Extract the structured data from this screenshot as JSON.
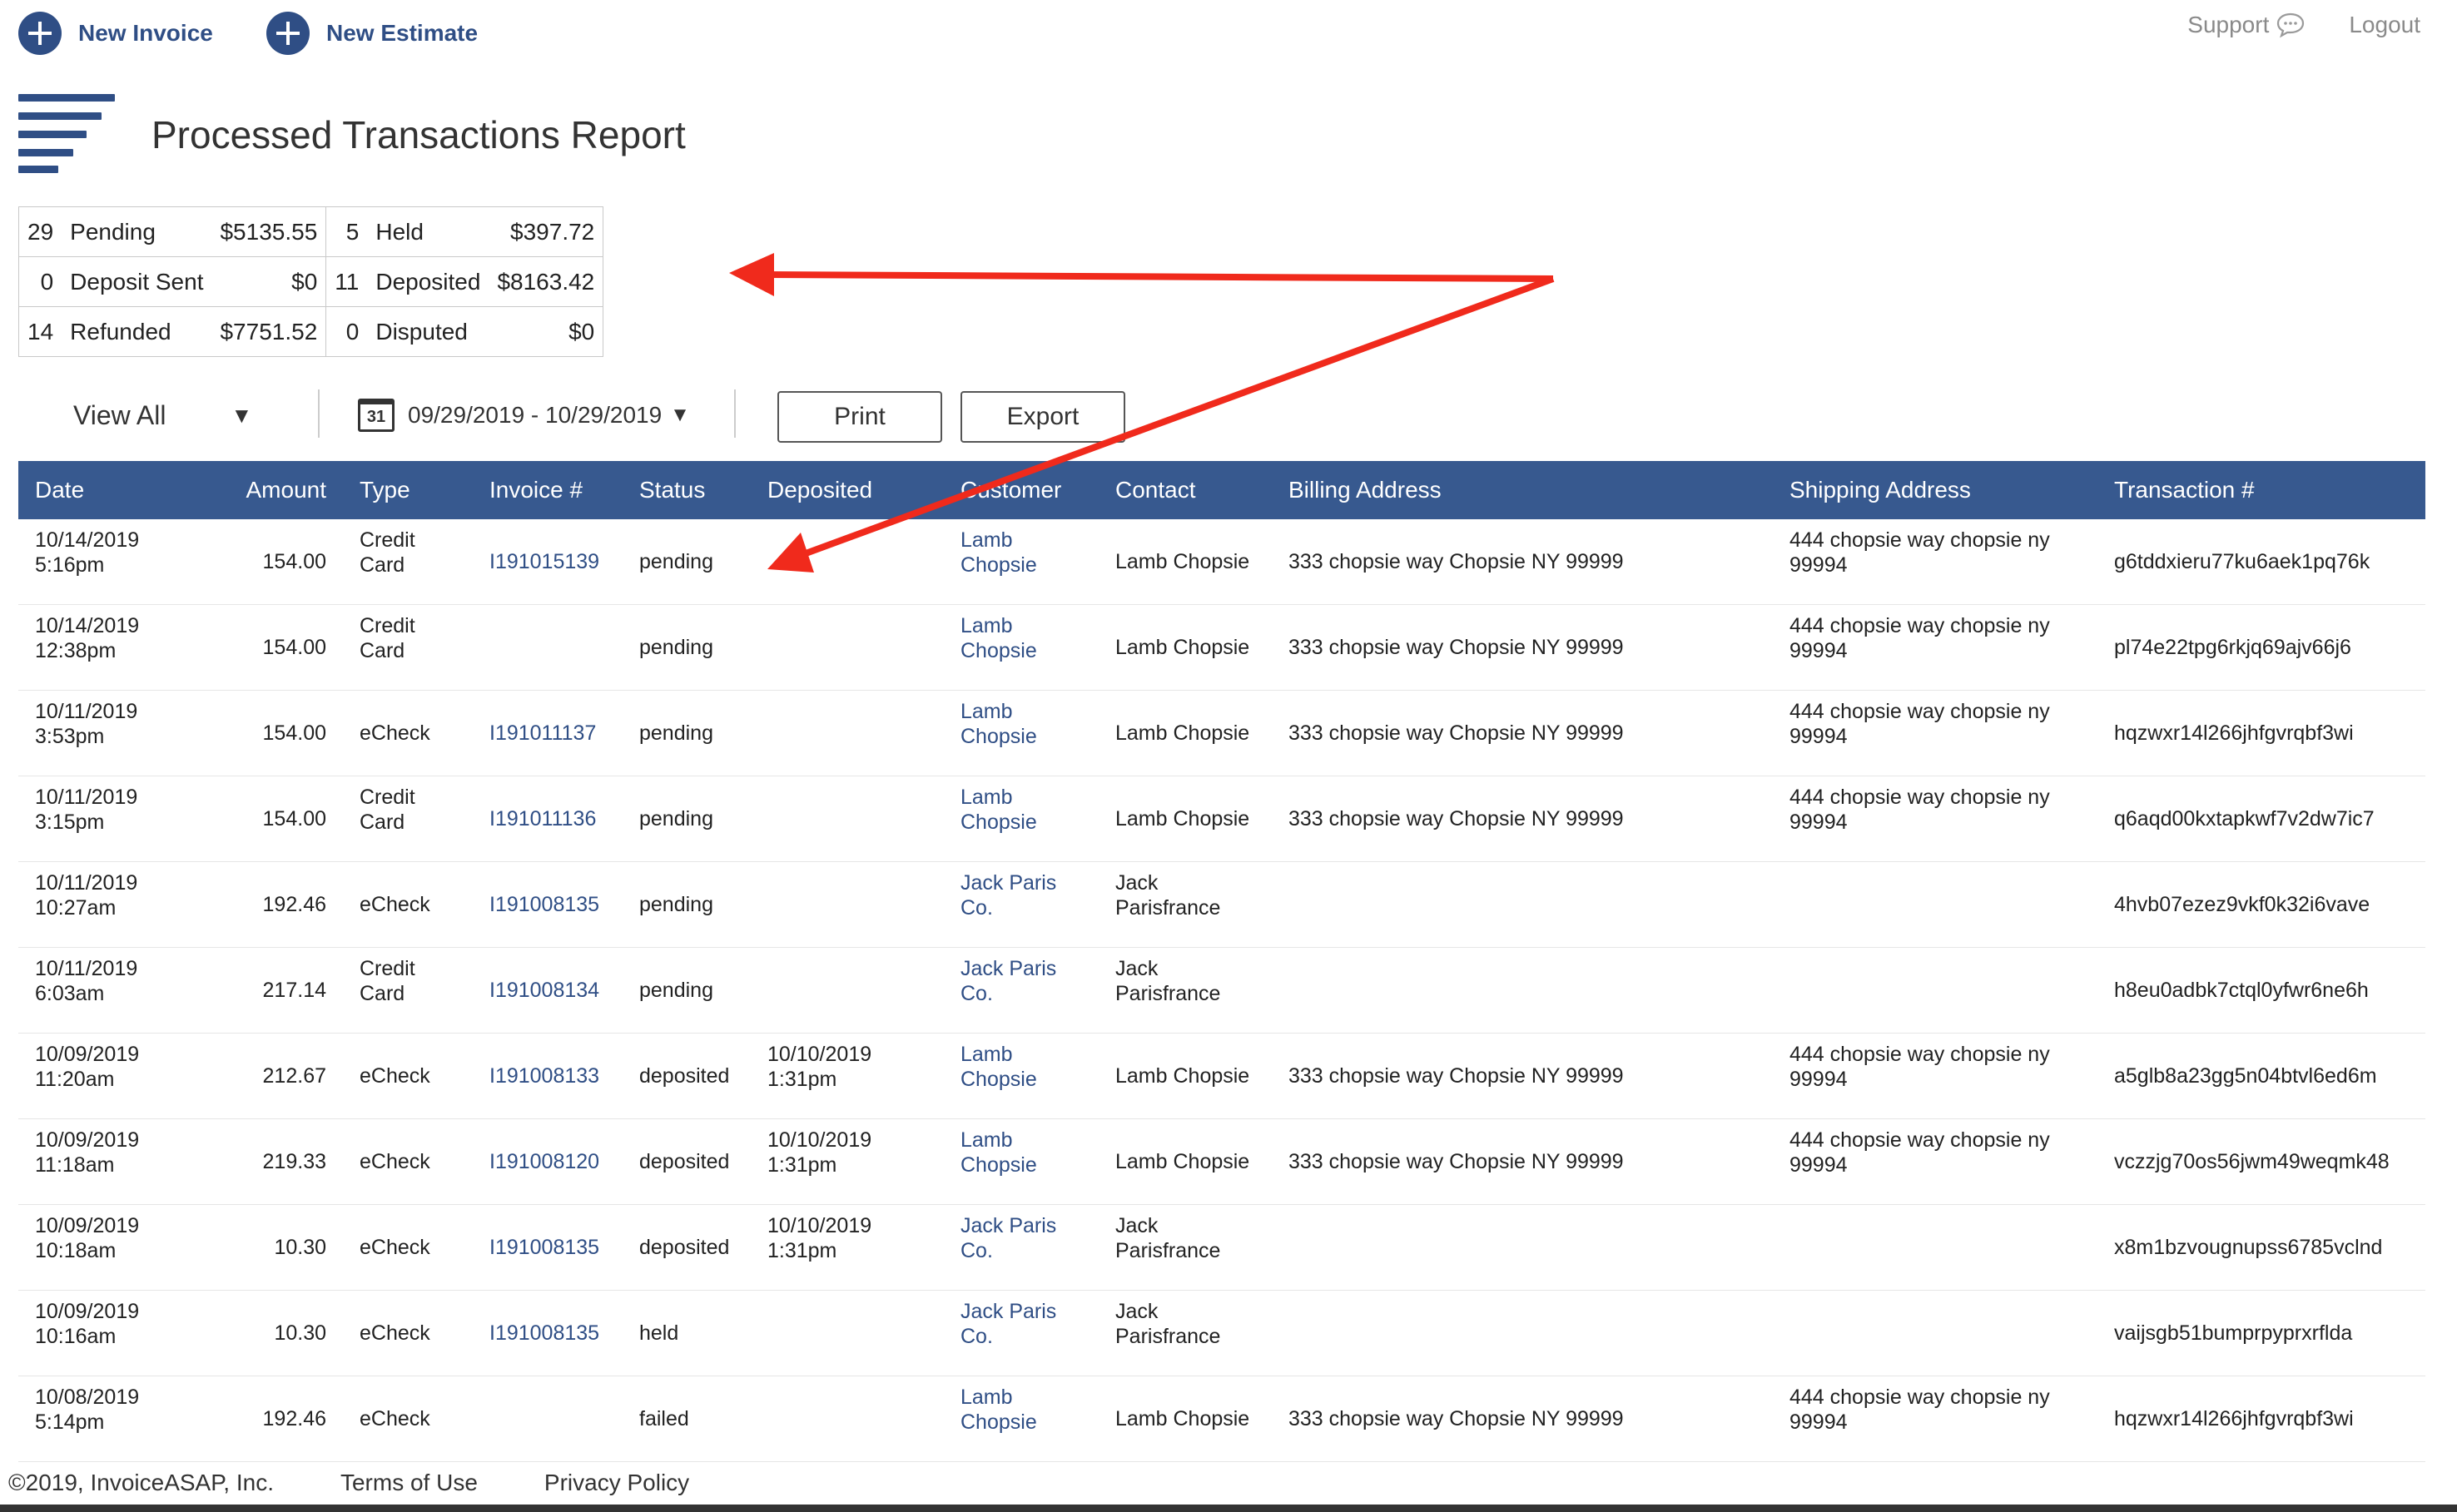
{
  "topbar": {
    "new_invoice": "New Invoice",
    "new_estimate": "New Estimate",
    "support": "Support",
    "logout": "Logout"
  },
  "page_title": "Processed Transactions Report",
  "summary": {
    "rows": [
      {
        "a_count": "29",
        "a_label": "Pending",
        "a_amount": "$5135.55",
        "b_count": "5",
        "b_label": "Held",
        "b_amount": "$397.72"
      },
      {
        "a_count": "0",
        "a_label": "Deposit Sent",
        "a_amount": "$0",
        "b_count": "11",
        "b_label": "Deposited",
        "b_amount": "$8163.42"
      },
      {
        "a_count": "14",
        "a_label": "Refunded",
        "a_amount": "$7751.52",
        "b_count": "0",
        "b_label": "Disputed",
        "b_amount": "$0"
      }
    ]
  },
  "controls": {
    "view_filter": "View All",
    "calendar_day": "31",
    "date_range": "09/29/2019 - 10/29/2019",
    "print": "Print",
    "export": "Export"
  },
  "table": {
    "headers": [
      "Date",
      "Amount",
      "Type",
      "Invoice #",
      "Status",
      "Deposited",
      "Customer",
      "Contact",
      "Billing Address",
      "Shipping Address",
      "Transaction #"
    ],
    "rows": [
      {
        "date": "10/14/2019",
        "time": "5:16pm",
        "amount": "154.00",
        "type1": "Credit",
        "type2": "Card",
        "invoice": "I191015139",
        "status": "pending",
        "dep_date": "",
        "dep_time": "",
        "cust1": "Lamb",
        "cust2": "Chopsie",
        "contact1": "Lamb Chopsie",
        "contact2": "",
        "billing": "333 chopsie way Chopsie NY 99999",
        "ship1": "444 chopsie way chopsie ny",
        "ship2": "99994",
        "txn": "g6tddxieru77ku6aek1pq76k"
      },
      {
        "date": "10/14/2019",
        "time": "12:38pm",
        "amount": "154.00",
        "type1": "Credit",
        "type2": "Card",
        "invoice": "",
        "status": "pending",
        "dep_date": "",
        "dep_time": "",
        "cust1": "Lamb",
        "cust2": "Chopsie",
        "contact1": "Lamb Chopsie",
        "contact2": "",
        "billing": "333 chopsie way Chopsie NY 99999",
        "ship1": "444 chopsie way chopsie ny",
        "ship2": "99994",
        "txn": "pl74e22tpg6rkjq69ajv66j6"
      },
      {
        "date": "10/11/2019",
        "time": "3:53pm",
        "amount": "154.00",
        "type1": "eCheck",
        "type2": "",
        "invoice": "I191011137",
        "status": "pending",
        "dep_date": "",
        "dep_time": "",
        "cust1": "Lamb",
        "cust2": "Chopsie",
        "contact1": "Lamb Chopsie",
        "contact2": "",
        "billing": "333 chopsie way Chopsie NY 99999",
        "ship1": "444 chopsie way chopsie ny",
        "ship2": "99994",
        "txn": "hqzwxr14l266jhfgvrqbf3wi"
      },
      {
        "date": "10/11/2019",
        "time": "3:15pm",
        "amount": "154.00",
        "type1": "Credit",
        "type2": "Card",
        "invoice": "I191011136",
        "status": "pending",
        "dep_date": "",
        "dep_time": "",
        "cust1": "Lamb",
        "cust2": "Chopsie",
        "contact1": "Lamb Chopsie",
        "contact2": "",
        "billing": "333 chopsie way Chopsie NY 99999",
        "ship1": "444 chopsie way chopsie ny",
        "ship2": "99994",
        "txn": "q6aqd00kxtapkwf7v2dw7ic7"
      },
      {
        "date": "10/11/2019",
        "time": "10:27am",
        "amount": "192.46",
        "type1": "eCheck",
        "type2": "",
        "invoice": "I191008135",
        "status": "pending",
        "dep_date": "",
        "dep_time": "",
        "cust1": "Jack Paris",
        "cust2": "Co.",
        "contact1": "Jack",
        "contact2": "Parisfrance",
        "billing": "",
        "ship1": "",
        "ship2": "",
        "txn": "4hvb07ezez9vkf0k32i6vave"
      },
      {
        "date": "10/11/2019",
        "time": "6:03am",
        "amount": "217.14",
        "type1": "Credit",
        "type2": "Card",
        "invoice": "I191008134",
        "status": "pending",
        "dep_date": "",
        "dep_time": "",
        "cust1": "Jack Paris",
        "cust2": "Co.",
        "contact1": "Jack",
        "contact2": "Parisfrance",
        "billing": "",
        "ship1": "",
        "ship2": "",
        "txn": "h8eu0adbk7ctql0yfwr6ne6h"
      },
      {
        "date": "10/09/2019",
        "time": "11:20am",
        "amount": "212.67",
        "type1": "eCheck",
        "type2": "",
        "invoice": "I191008133",
        "status": "deposited",
        "dep_date": "10/10/2019",
        "dep_time": "1:31pm",
        "cust1": "Lamb",
        "cust2": "Chopsie",
        "contact1": "Lamb Chopsie",
        "contact2": "",
        "billing": "333 chopsie way Chopsie NY 99999",
        "ship1": "444 chopsie way chopsie ny",
        "ship2": "99994",
        "txn": "a5glb8a23gg5n04btvl6ed6m"
      },
      {
        "date": "10/09/2019",
        "time": "11:18am",
        "amount": "219.33",
        "type1": "eCheck",
        "type2": "",
        "invoice": "I191008120",
        "status": "deposited",
        "dep_date": "10/10/2019",
        "dep_time": "1:31pm",
        "cust1": "Lamb",
        "cust2": "Chopsie",
        "contact1": "Lamb Chopsie",
        "contact2": "",
        "billing": "333 chopsie way Chopsie NY 99999",
        "ship1": "444 chopsie way chopsie ny",
        "ship2": "99994",
        "txn": "vczzjg70os56jwm49weqmk48"
      },
      {
        "date": "10/09/2019",
        "time": "10:18am",
        "amount": "10.30",
        "type1": "eCheck",
        "type2": "",
        "invoice": "I191008135",
        "status": "deposited",
        "dep_date": "10/10/2019",
        "dep_time": "1:31pm",
        "cust1": "Jack Paris",
        "cust2": "Co.",
        "contact1": "Jack",
        "contact2": "Parisfrance",
        "billing": "",
        "ship1": "",
        "ship2": "",
        "txn": "x8m1bzvougnupss6785vclnd"
      },
      {
        "date": "10/09/2019",
        "time": "10:16am",
        "amount": "10.30",
        "type1": "eCheck",
        "type2": "",
        "invoice": "I191008135",
        "status": "held",
        "dep_date": "",
        "dep_time": "",
        "cust1": "Jack Paris",
        "cust2": "Co.",
        "contact1": "Jack",
        "contact2": "Parisfrance",
        "billing": "",
        "ship1": "",
        "ship2": "",
        "txn": "vaijsgb51bumprpyprxrflda"
      },
      {
        "date": "10/08/2019",
        "time": "5:14pm",
        "amount": "192.46",
        "type1": "eCheck",
        "type2": "",
        "invoice": "",
        "status": "failed",
        "dep_date": "",
        "dep_time": "",
        "cust1": "Lamb",
        "cust2": "Chopsie",
        "contact1": "Lamb Chopsie",
        "contact2": "",
        "billing": "333 chopsie way Chopsie NY 99999",
        "ship1": "444 chopsie way chopsie ny",
        "ship2": "99994",
        "txn": "hqzwxr14l266jhfgvrqbf3wi"
      }
    ]
  },
  "footer": {
    "copyright": "©2019, InvoiceASAP, Inc.",
    "terms": "Terms of Use",
    "privacy": "Privacy Policy"
  },
  "colors": {
    "brand": "#2f4e85",
    "header_bg": "#37598f",
    "annotation_arrow": "#f02a1c"
  },
  "icons": {
    "new_invoice": "plus-circle-icon",
    "new_estimate": "plus-circle-icon",
    "support": "chat-bubble-icon",
    "report": "report-lines-icon",
    "view_filter": "caret-down-icon",
    "date": "calendar-icon"
  }
}
